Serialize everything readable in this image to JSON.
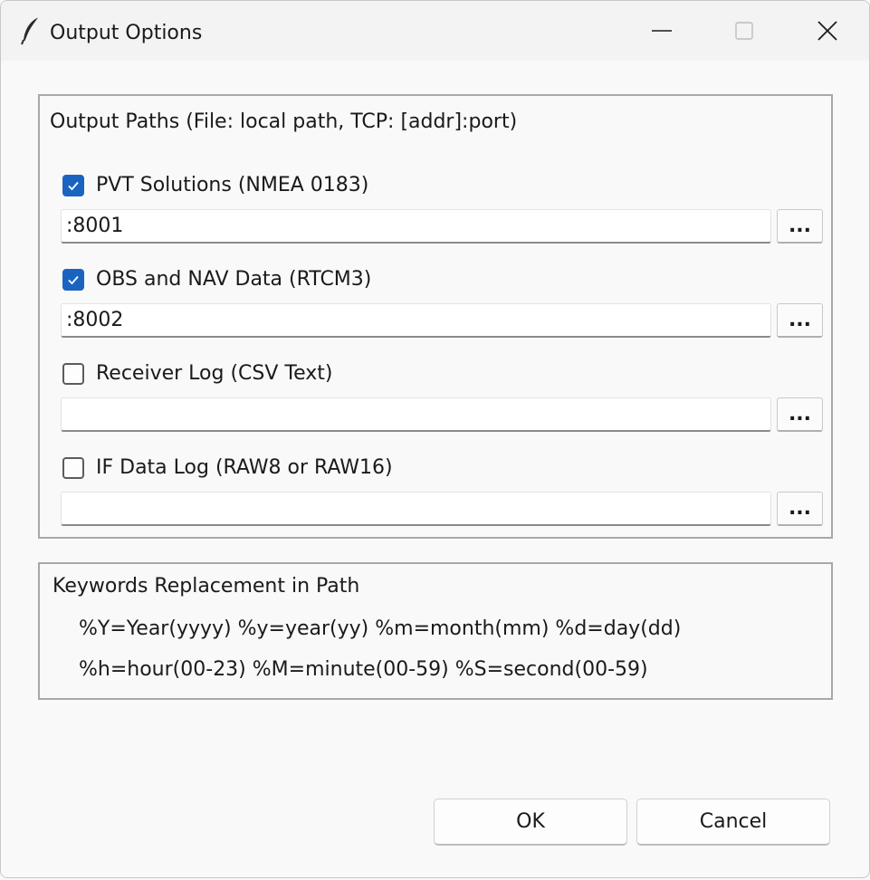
{
  "window": {
    "title": "Output Options",
    "icon": "feather-icon"
  },
  "output_paths": {
    "title": "Output Paths (File: local path, TCP: [addr]:port)",
    "items": [
      {
        "label": "PVT Solutions (NMEA 0183)",
        "checked": true,
        "value": ":8001",
        "browse_label": "..."
      },
      {
        "label": "OBS and NAV Data (RTCM3)",
        "checked": true,
        "value": ":8002",
        "browse_label": "..."
      },
      {
        "label": "Receiver Log (CSV Text)",
        "checked": false,
        "value": "",
        "browse_label": "..."
      },
      {
        "label": "IF Data Log (RAW8 or RAW16)",
        "checked": false,
        "value": "",
        "browse_label": "..."
      }
    ]
  },
  "keywords": {
    "title": "Keywords Replacement in Path",
    "lines": [
      "%Y=Year(yyyy) %y=year(yy) %m=month(mm) %d=day(dd)",
      "%h=hour(00-23) %M=minute(00-59) %S=second(00-59)"
    ]
  },
  "buttons": {
    "ok": "OK",
    "cancel": "Cancel"
  },
  "colors": {
    "accent": "#1a64c0",
    "background": "#f9f9f9",
    "group_border": "#a8a8a8"
  }
}
